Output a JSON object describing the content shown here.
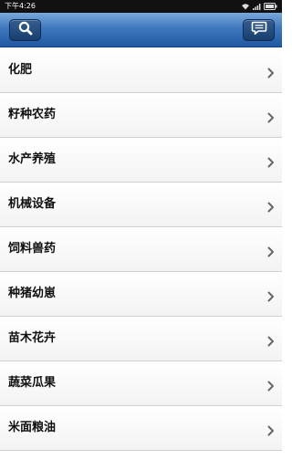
{
  "status_bar": {
    "time": "下午4:26",
    "icons": [
      "wifi-icon",
      "signal-icon",
      "battery-icon"
    ]
  },
  "header": {
    "left_icon": "search-icon",
    "right_icon": "message-icon",
    "gradient_top": "#7aa8dc",
    "gradient_bottom": "#1f58a3"
  },
  "categories": [
    {
      "label": "化肥"
    },
    {
      "label": "籽种农药"
    },
    {
      "label": "水产养殖"
    },
    {
      "label": "机械设备"
    },
    {
      "label": "饲料兽药"
    },
    {
      "label": "种猪幼崽"
    },
    {
      "label": "苗木花卉"
    },
    {
      "label": "蔬菜瓜果"
    },
    {
      "label": "米面粮油"
    }
  ]
}
